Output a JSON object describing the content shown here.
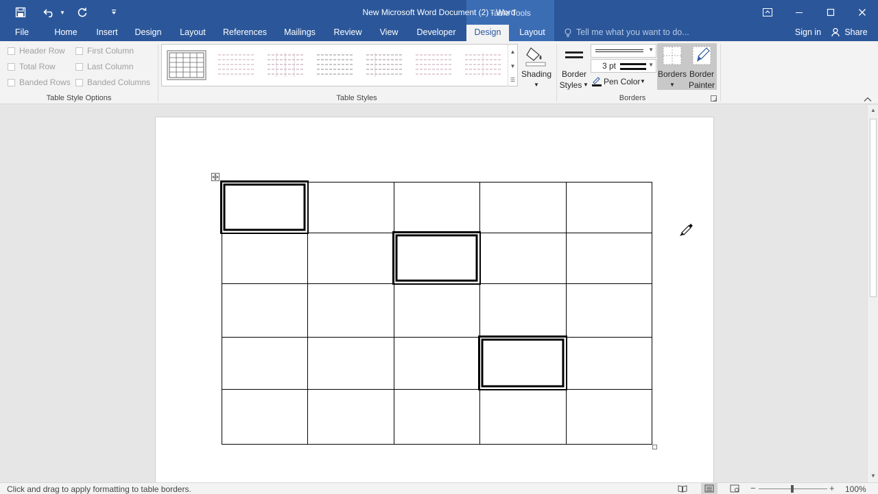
{
  "window": {
    "title": "New Microsoft Word Document (2) - Word",
    "context_tab_group": "Table Tools",
    "accent_color": "#2b579a"
  },
  "quick_access": {
    "icons": [
      "save-icon",
      "undo-icon",
      "redo-icon",
      "customize-qat-icon"
    ]
  },
  "tabs": [
    {
      "label": "File"
    },
    {
      "label": "Home"
    },
    {
      "label": "Insert"
    },
    {
      "label": "Design"
    },
    {
      "label": "Layout"
    },
    {
      "label": "References"
    },
    {
      "label": "Mailings"
    },
    {
      "label": "Review"
    },
    {
      "label": "View"
    },
    {
      "label": "Developer"
    },
    {
      "label": "Design",
      "active": true
    },
    {
      "label": "Layout"
    }
  ],
  "tell_me": "Tell me what you want to do...",
  "account": {
    "sign_in": "Sign in",
    "share": "Share"
  },
  "ribbon": {
    "table_style_options": {
      "label": "Table Style Options",
      "checkboxes": [
        {
          "label": "Header Row",
          "checked": false
        },
        {
          "label": "Total Row",
          "checked": false
        },
        {
          "label": "Banded Rows",
          "checked": false
        },
        {
          "label": "First Column",
          "checked": false
        },
        {
          "label": "Last Column",
          "checked": false
        },
        {
          "label": "Banded Columns",
          "checked": false
        }
      ]
    },
    "table_styles": {
      "label": "Table Styles",
      "shading_label": "Shading"
    },
    "borders": {
      "label": "Borders",
      "border_styles_line1": "Border",
      "border_styles_line2": "Styles",
      "line_weight": "3 pt",
      "pen_color": "Pen Color",
      "borders_button": "Borders",
      "border_painter_line1": "Border",
      "border_painter_line2": "Painter"
    }
  },
  "table": {
    "rows": 5,
    "cols": 5,
    "double_bordered_cells": [
      [
        0,
        0
      ],
      [
        1,
        2
      ],
      [
        3,
        3
      ]
    ]
  },
  "status": {
    "message": "Click and drag to apply formatting to table borders.",
    "zoom": "100%"
  }
}
